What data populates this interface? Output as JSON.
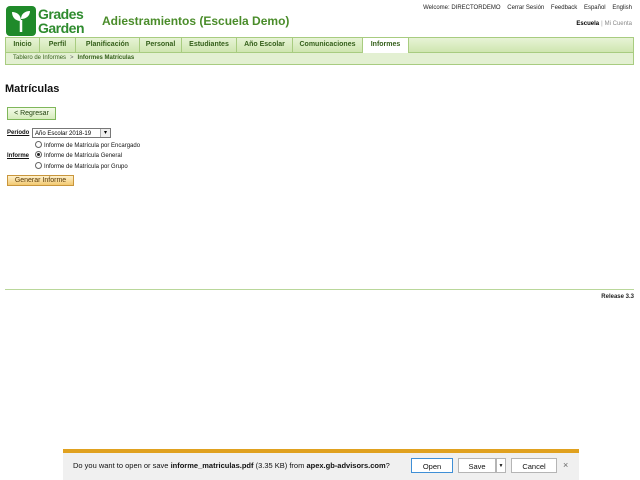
{
  "header": {
    "logo_line1": "Grades",
    "logo_line2": "Garden",
    "school_title": "Adiestramientos (Escuela Demo)",
    "topbar": {
      "welcome": "Welcome: DIRECTORDEMO",
      "logout": "Cerrar Sesión",
      "feedback": "Feedback",
      "lang_es": "Español",
      "lang_en": "English"
    },
    "account": {
      "selected": "Escuela",
      "separator": "|",
      "other": "Mi Cuenta"
    }
  },
  "nav": {
    "tabs": [
      "Inicio",
      "Perfil",
      "Planificación",
      "Personal",
      "Estudiantes",
      "Año Escolar",
      "Comunicaciones",
      "Informes"
    ],
    "active_tab": "Informes"
  },
  "breadcrumb": {
    "parent": "Tablero de Informes",
    "separator": ">",
    "current": "Informes Matrículas"
  },
  "main": {
    "title": "Matrículas",
    "back_button": "< Regresar",
    "periodo_label": "Período",
    "periodo_value": "Año Escolar 2018-19",
    "informe_label": "Informe",
    "informe_options": [
      {
        "label": "Informe de Matrícula por Encargado",
        "selected": false
      },
      {
        "label": "Informe de Matrícula General",
        "selected": true
      },
      {
        "label": "Informe de Matrícula por Grupo",
        "selected": false
      }
    ],
    "generate_button": "Generar Informe"
  },
  "footer": {
    "release": "Release 3.3"
  },
  "download_bar": {
    "prefix": "Do you want to open or save ",
    "filename": "informe_matriculas.pdf",
    "size": " (3.35 KB) from ",
    "host": "apex.gb-advisors.com",
    "suffix": "?",
    "open_label": "Open",
    "save_label": "Save",
    "cancel_label": "Cancel",
    "close_glyph": "×",
    "dropdown_glyph": "▼"
  },
  "colors": {
    "brand_green": "#2e8b2e",
    "nav_border": "#a8cc80",
    "download_accent": "#e0a11f"
  }
}
